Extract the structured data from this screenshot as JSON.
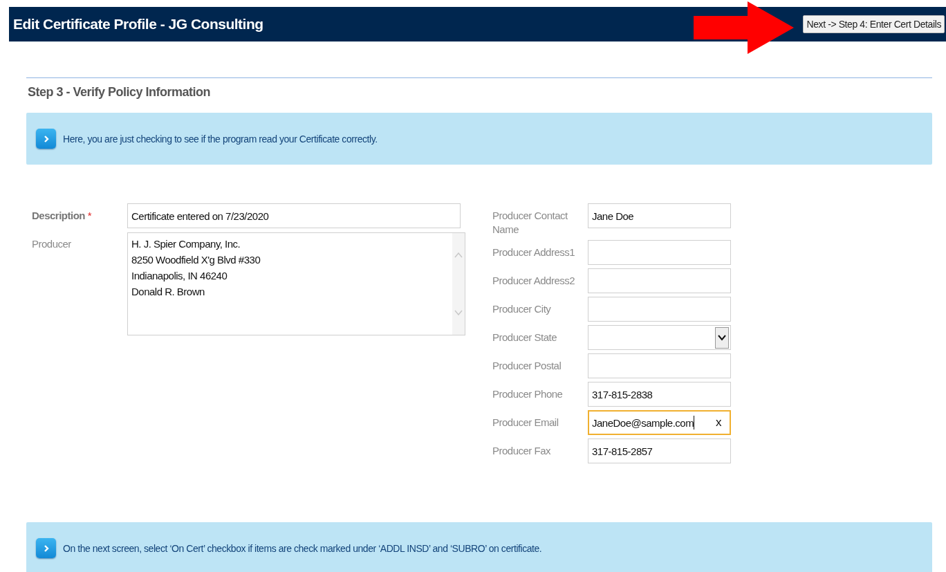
{
  "header": {
    "title": "Edit Certificate Profile - JG Consulting",
    "next_button": "Next -> Step 4: Enter Cert Details"
  },
  "step_title": "Step 3 - Verify Policy Information",
  "notices": [
    {
      "text": "Here, you are just checking to see if the program read your Certificate correctly."
    },
    {
      "text": "On the next screen, select ‘On Cert’ checkbox if items are check marked under ‘ADDL INSD’ and ‘SUBRO’ on certificate."
    }
  ],
  "left_fields": [
    {
      "kind": "text",
      "label": "Description",
      "required_mark": "*",
      "value": "Certificate entered on 7/23/2020",
      "focused": false
    },
    {
      "kind": "textarea",
      "label": "Producer",
      "lines": [
        "H. J. Spier Company, Inc.",
        "8250 Woodfield X'g Blvd #330",
        "Indianapolis, IN 46240",
        "Donald R. Brown"
      ],
      "focused": false
    }
  ],
  "right_fields": [
    {
      "kind": "text",
      "label": "Producer Contact Name",
      "value": "Jane Doe",
      "focused": false
    },
    {
      "kind": "text",
      "label": "Producer Address1",
      "focused": false
    },
    {
      "kind": "text",
      "label": "Producer Address2",
      "focused": false
    },
    {
      "kind": "text",
      "label": "Producer City",
      "focused": false
    },
    {
      "kind": "select",
      "label": "Producer State",
      "focused": false
    },
    {
      "kind": "text",
      "label": "Producer Postal",
      "focused": false
    },
    {
      "kind": "text",
      "label": "Producer Phone",
      "value": "317-815-2838",
      "focused": false
    },
    {
      "kind": "text",
      "label": "Producer Email",
      "value": "JaneDoe@sample.com",
      "clear_button": "x",
      "focused": true
    },
    {
      "kind": "text",
      "label": "Producer Fax",
      "value": "317-815-2857",
      "focused": false
    }
  ]
}
